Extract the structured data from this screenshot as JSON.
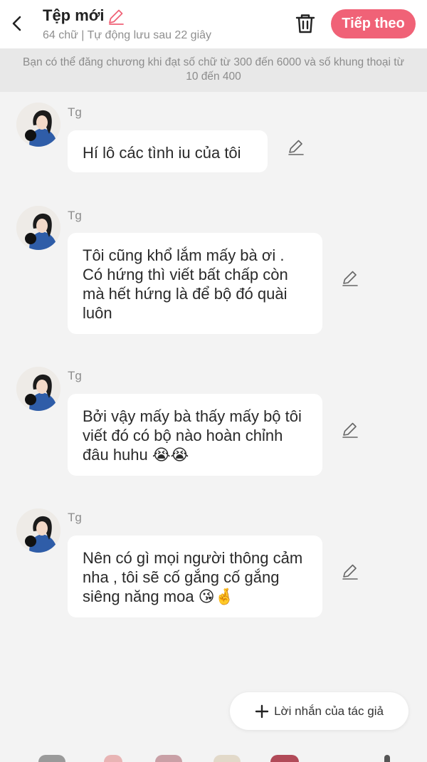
{
  "header": {
    "title": "Tệp mới",
    "subtitle": "64 chữ | Tự động lưu sau 22 giây",
    "next_label": "Tiếp theo"
  },
  "notice": {
    "text": "Bạn có thể đăng chương khi đạt số chữ từ 300 đến 6000 và số khung thoại từ 10 đến 400"
  },
  "messages": [
    {
      "sender": "Tg",
      "text": "Hí lô các tình iu của tôi"
    },
    {
      "sender": "Tg",
      "text": "Tôi cũng khổ lắm mấy bà ơi . Có hứng thì viết bất chấp còn mà hết hứng là để bộ đó quài luôn"
    },
    {
      "sender": "Tg",
      "text": "Bởi vậy mấy bà thấy mấy bộ tôi viết đó có bộ nào hoàn chỉnh đâu huhu 😭😭"
    },
    {
      "sender": "Tg",
      "text": "Nên có gì mọi người thông cảm nha , tôi sẽ cố gắng cố gắng siêng năng moa 😘🤞"
    }
  ],
  "author_note": {
    "label": "Lời nhắn của tác giả"
  },
  "colors": {
    "accent": "#f06277",
    "background": "#f3f3f3",
    "notice_bg": "#e8e8e8"
  },
  "icons": [
    "back-arrow-icon",
    "pencil-icon",
    "trash-icon",
    "plus-icon"
  ]
}
